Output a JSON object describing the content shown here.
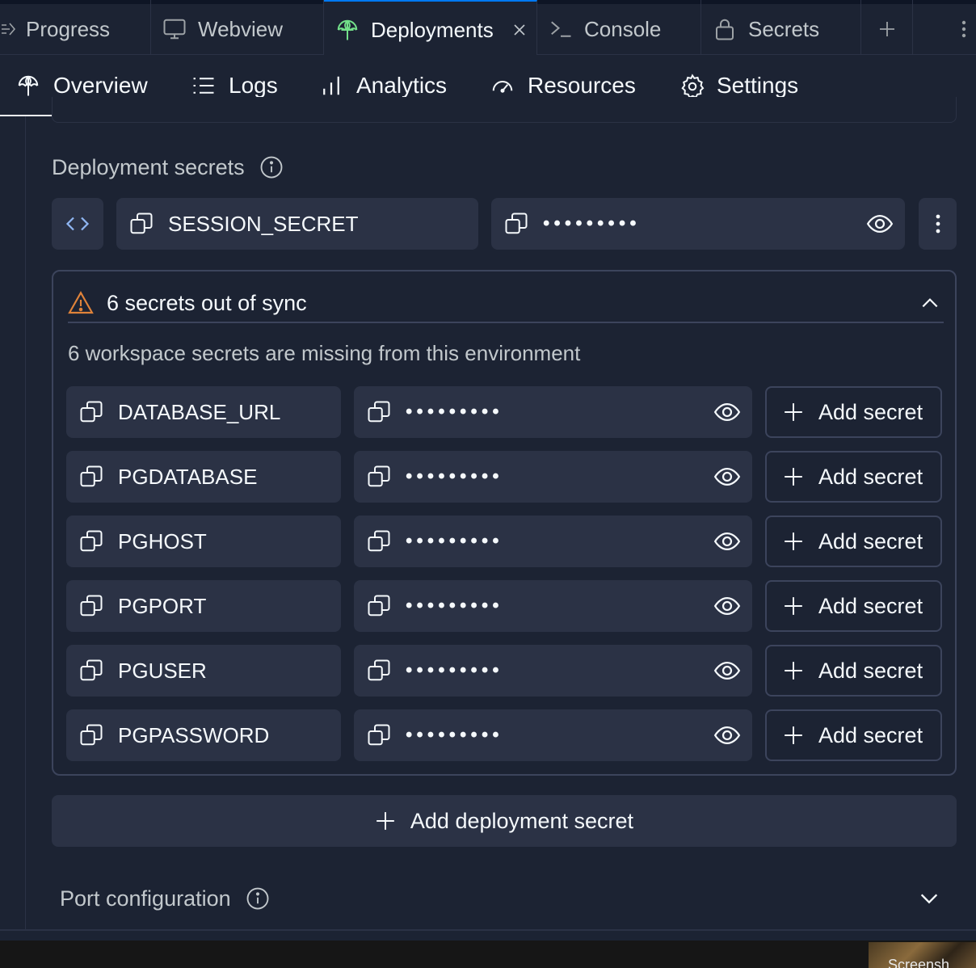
{
  "tabs": [
    {
      "label": "Progress",
      "icon": "progress-icon"
    },
    {
      "label": "Webview",
      "icon": "monitor-icon"
    },
    {
      "label": "Deployments",
      "icon": "deploy-icon",
      "active": true
    },
    {
      "label": "Console",
      "icon": "terminal-icon"
    },
    {
      "label": "Secrets",
      "icon": "lock-icon"
    }
  ],
  "subnav": {
    "overview": "Overview",
    "logs": "Logs",
    "analytics": "Analytics",
    "resources": "Resources",
    "settings": "Settings"
  },
  "deployment_secrets": {
    "title": "Deployment secrets",
    "existing": {
      "key": "SESSION_SECRET",
      "value": "•••••••••"
    }
  },
  "out_of_sync": {
    "title": "6 secrets out of sync",
    "description": "6 workspace secrets are missing from this environment",
    "add_label": "Add secret",
    "rows": [
      {
        "key": "DATABASE_URL",
        "value": "•••••••••"
      },
      {
        "key": "PGDATABASE",
        "value": "•••••••••"
      },
      {
        "key": "PGHOST",
        "value": "•••••••••"
      },
      {
        "key": "PGPORT",
        "value": "•••••••••"
      },
      {
        "key": "PGUSER",
        "value": "•••••••••"
      },
      {
        "key": "PGPASSWORD",
        "value": "•••••••••"
      }
    ]
  },
  "add_deployment_secret": "Add deployment secret",
  "port_configuration": "Port configuration",
  "taskbar_thumb": "Screensh",
  "colors": {
    "background": "#1c2333",
    "field": "#2b3245",
    "border": "#3c445c",
    "warning": "#e0833a",
    "accent": "#0079f2",
    "deploy_icon": "#73e08a"
  }
}
